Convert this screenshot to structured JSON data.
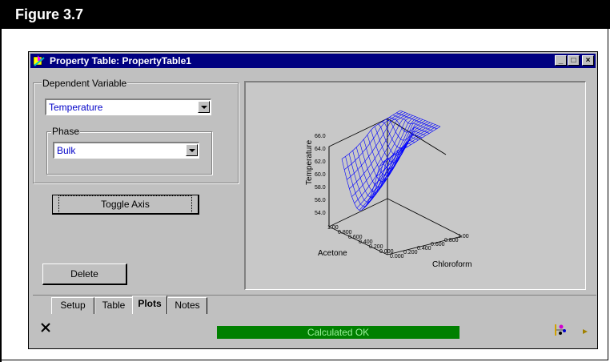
{
  "figure": {
    "title": "Figure 3.7"
  },
  "window": {
    "title": "Property Table: PropertyTable1",
    "controls": {
      "minimize": "_",
      "maximize": "□",
      "close": "×"
    }
  },
  "dependent_variable": {
    "label": "Dependent Variable",
    "value": "Temperature"
  },
  "phase": {
    "label": "Phase",
    "value": "Bulk"
  },
  "buttons": {
    "toggle_axis": "Toggle Axis",
    "delete": "Delete"
  },
  "plot": {
    "z_label": "Temperature",
    "x_label": "Acetone",
    "y_label": "Chloroform",
    "z_ticks": [
      "66.0",
      "64.0",
      "62.0",
      "60.0",
      "58.0",
      "56.0",
      "54.0"
    ],
    "x_ticks": [
      "0.000",
      "0.200",
      "0.400",
      "0.600",
      "0.800",
      "1.00"
    ],
    "y_ticks": [
      "0.000",
      "0.200",
      "0.400",
      "0.600",
      "0.800",
      "1.00"
    ],
    "surface_color": "#0000ff"
  },
  "tabs": [
    {
      "label": "Setup"
    },
    {
      "label": "Table"
    },
    {
      "label": "Plots"
    },
    {
      "label": "Notes"
    }
  ],
  "status": {
    "text": "Calculated OK",
    "color": "#008000"
  },
  "icons": {
    "close": "delete-x-icon",
    "hierarchy": "object-hierarchy-icon",
    "arrow": "right-arrow-icon"
  }
}
